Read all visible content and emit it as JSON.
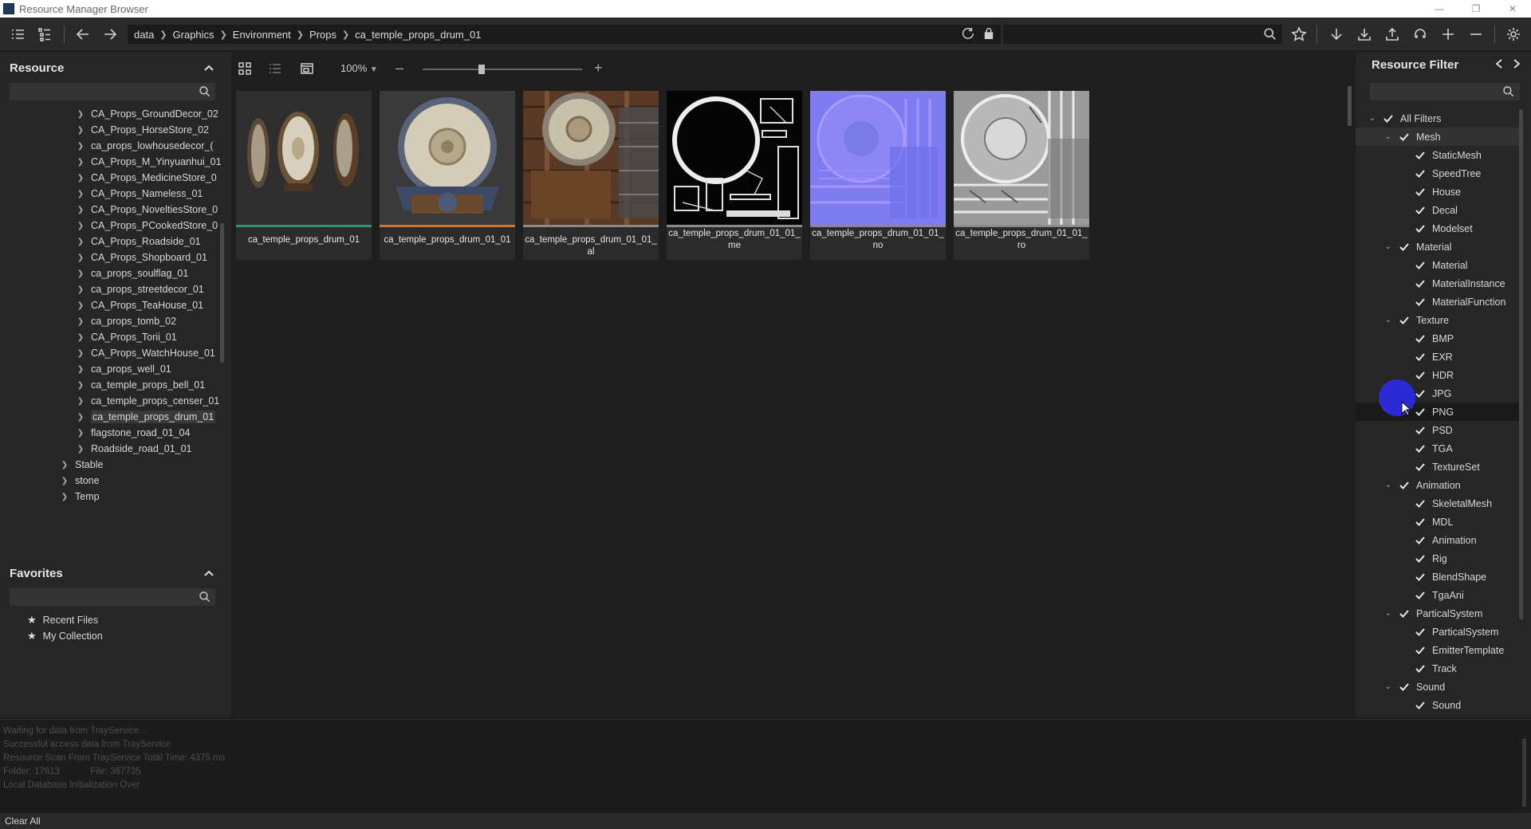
{
  "window": {
    "title": "Resource Manager Browser"
  },
  "breadcrumb": [
    "data",
    "Graphics",
    "Environment",
    "Props",
    "ca_temple_props_drum_01"
  ],
  "resource_panel": {
    "title": "Resource",
    "tree": [
      {
        "label": "CA_Props_GroundDecor_02",
        "level": 2
      },
      {
        "label": "CA_Props_HorseStore_02",
        "level": 2
      },
      {
        "label": "ca_props_lowhousedecor_(",
        "level": 2
      },
      {
        "label": "CA_Props_M_Yinyuanhui_01",
        "level": 2
      },
      {
        "label": "CA_Props_MedicineStore_0",
        "level": 2
      },
      {
        "label": "CA_Props_Nameless_01",
        "level": 2
      },
      {
        "label": "CA_Props_NoveltiesStore_0",
        "level": 2
      },
      {
        "label": "CA_Props_PCookedStore_0",
        "level": 2
      },
      {
        "label": "CA_Props_Roadside_01",
        "level": 2
      },
      {
        "label": "CA_Props_Shopboard_01",
        "level": 2
      },
      {
        "label": "ca_props_soulflag_01",
        "level": 2
      },
      {
        "label": "ca_props_streetdecor_01",
        "level": 2
      },
      {
        "label": "CA_Props_TeaHouse_01",
        "level": 2
      },
      {
        "label": "ca_props_tomb_02",
        "level": 2
      },
      {
        "label": "CA_Props_Torii_01",
        "level": 2
      },
      {
        "label": "CA_Props_WatchHouse_01",
        "level": 2
      },
      {
        "label": "ca_props_well_01",
        "level": 2
      },
      {
        "label": "ca_temple_props_bell_01",
        "level": 2
      },
      {
        "label": "ca_temple_props_censer_01",
        "level": 2
      },
      {
        "label": "ca_temple_props_drum_01",
        "level": 2,
        "selected": true
      },
      {
        "label": "flagstone_road_01_04",
        "level": 2
      },
      {
        "label": "Roadside_road_01_01",
        "level": 2
      },
      {
        "label": "Stable",
        "level": 1
      },
      {
        "label": "stone",
        "level": 1
      },
      {
        "label": "Temp",
        "level": 1
      }
    ]
  },
  "favorites_panel": {
    "title": "Favorites",
    "items": [
      "Recent Files",
      "My Collection"
    ]
  },
  "view_bar": {
    "zoom": "100%",
    "slider_fraction": 0.37
  },
  "assets": [
    {
      "label": "ca_temple_props_drum_01",
      "kind": "model",
      "bar_color": "#3a8f7a"
    },
    {
      "label": "ca_temple_props_drum_01_01",
      "kind": "mesh",
      "bar_color": "#c8743a"
    },
    {
      "label": "ca_temple_props_drum_01_01_al",
      "kind": "albedo",
      "bar_color": "#8a8a8a"
    },
    {
      "label": "ca_temple_props_drum_01_01_me",
      "kind": "metal",
      "bar_color": "#8a8a8a"
    },
    {
      "label": "ca_temple_props_drum_01_01_no",
      "kind": "normal",
      "bar_color": "#8a8a8a"
    },
    {
      "label": "ca_temple_props_drum_01_01_ro",
      "kind": "rough",
      "bar_color": "#8a8a8a"
    }
  ],
  "filter_panel": {
    "title": "Resource Filter",
    "filters": [
      {
        "label": "All Filters",
        "level": 0,
        "expandable": true
      },
      {
        "label": "Mesh",
        "level": 1,
        "expandable": true,
        "highlight": true
      },
      {
        "label": "StaticMesh",
        "level": 2
      },
      {
        "label": "SpeedTree",
        "level": 2
      },
      {
        "label": "House",
        "level": 2
      },
      {
        "label": "Decal",
        "level": 2
      },
      {
        "label": "Modelset",
        "level": 2
      },
      {
        "label": "Material",
        "level": 1,
        "expandable": true
      },
      {
        "label": "Material",
        "level": 2
      },
      {
        "label": "MaterialInstance",
        "level": 2
      },
      {
        "label": "MaterialFunction",
        "level": 2
      },
      {
        "label": "Texture",
        "level": 1,
        "expandable": true
      },
      {
        "label": "BMP",
        "level": 2
      },
      {
        "label": "EXR",
        "level": 2
      },
      {
        "label": "HDR",
        "level": 2
      },
      {
        "label": "JPG",
        "level": 2
      },
      {
        "label": "PNG",
        "level": 2,
        "dark": true
      },
      {
        "label": "PSD",
        "level": 2
      },
      {
        "label": "TGA",
        "level": 2
      },
      {
        "label": "TextureSet",
        "level": 2
      },
      {
        "label": "Animation",
        "level": 1,
        "expandable": true
      },
      {
        "label": "SkeletalMesh",
        "level": 2
      },
      {
        "label": "MDL",
        "level": 2
      },
      {
        "label": "Animation",
        "level": 2
      },
      {
        "label": "Rig",
        "level": 2
      },
      {
        "label": "BlendShape",
        "level": 2
      },
      {
        "label": "TgaAni",
        "level": 2
      },
      {
        "label": "ParticalSystem",
        "level": 1,
        "expandable": true
      },
      {
        "label": "ParticalSystem",
        "level": 2
      },
      {
        "label": "EmitterTemplate",
        "level": 2
      },
      {
        "label": "Track",
        "level": 2
      },
      {
        "label": "Sound",
        "level": 1,
        "expandable": true
      },
      {
        "label": "Sound",
        "level": 2
      }
    ]
  },
  "log": [
    "Waiting for data from TrayService...",
    "Successful access data from TrayService",
    "Resource Scan From TrayService Total Time: 4375 ms",
    "Folder: 17813            File: 367735",
    "Local Database Initialization Over"
  ],
  "statusbar": {
    "clear_all": "Clear All"
  }
}
